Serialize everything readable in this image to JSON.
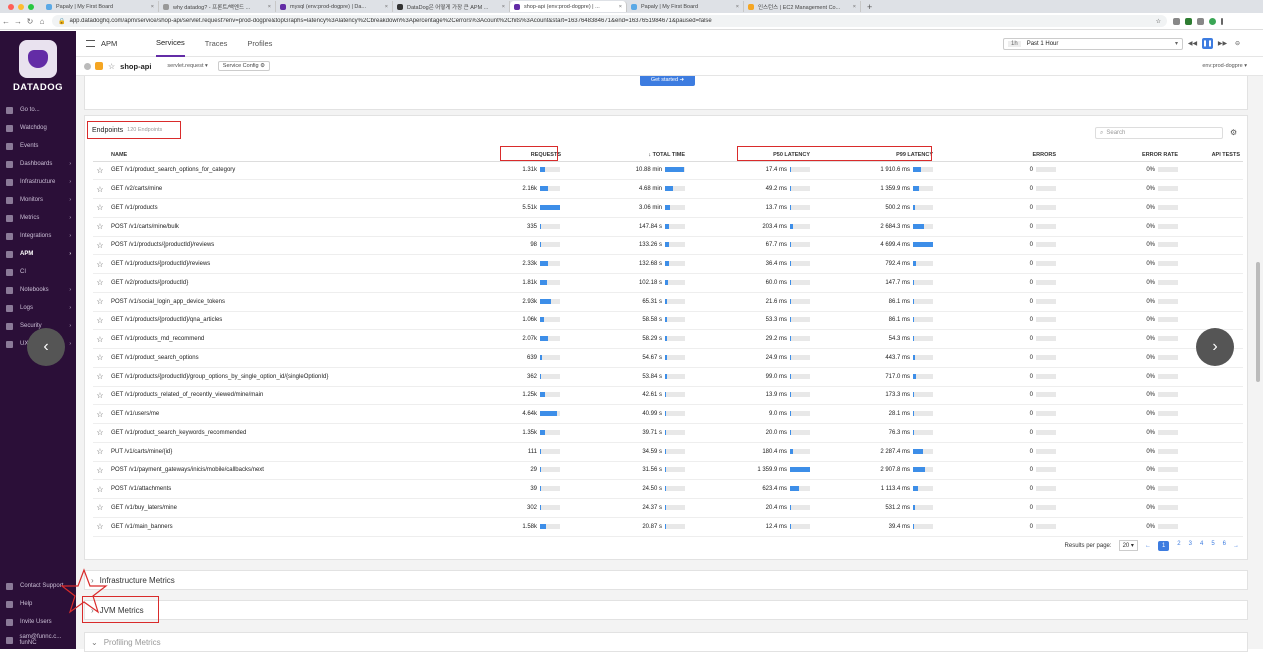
{
  "browser": {
    "tabs": [
      {
        "title": "Papaly | My First Board",
        "active": false,
        "color": "#5aa9e6"
      },
      {
        "title": "why datadog? - 프론트/백엔드 ...",
        "active": false,
        "color": "#999999"
      },
      {
        "title": "mysql (env:prod-dogpre) | Da...",
        "active": false,
        "color": "#632ca6"
      },
      {
        "title": "DataDog은 어떻게 가장 큰 APM ...",
        "active": false,
        "color": "#333333"
      },
      {
        "title": "shop-api (env:prod-dogpre) | ...",
        "active": true,
        "color": "#632ca6"
      },
      {
        "title": "Papaly | My First Board",
        "active": false,
        "color": "#5aa9e6"
      },
      {
        "title": "인스턴스 | EC2 Management Co...",
        "active": false,
        "color": "#f5a623"
      }
    ],
    "new_tab": "+",
    "url": "app.datadoghq.com/apm/service/shop-api/servlet.request?env=prod-dogpre&topGraphs=latency%3Alatency%2Cbreakdown%3Apercentage%2Cerrors%3Acount%2Chits%3Acount&start=1637648384671&end=1637651984671&paused=false"
  },
  "sidebar": {
    "brand": "DATADOG",
    "items": [
      {
        "label": "Go to...",
        "active": false,
        "arrow": ""
      },
      {
        "label": "Watchdog",
        "active": false,
        "arrow": ""
      },
      {
        "label": "Events",
        "active": false,
        "arrow": ""
      },
      {
        "label": "Dashboards",
        "active": false,
        "arrow": "›"
      },
      {
        "label": "Infrastructure",
        "active": false,
        "arrow": "›"
      },
      {
        "label": "Monitors",
        "active": false,
        "arrow": "›"
      },
      {
        "label": "Metrics",
        "active": false,
        "arrow": "›"
      },
      {
        "label": "Integrations",
        "active": false,
        "arrow": "›"
      },
      {
        "label": "APM",
        "active": true,
        "arrow": "›"
      },
      {
        "label": "CI",
        "active": false,
        "arrow": ""
      },
      {
        "label": "Notebooks",
        "active": false,
        "arrow": "›"
      },
      {
        "label": "Logs",
        "active": false,
        "arrow": "›"
      },
      {
        "label": "Security",
        "active": false,
        "arrow": "›"
      },
      {
        "label": "UX Monitoring",
        "active": false,
        "arrow": "›"
      }
    ],
    "bottom": [
      {
        "label": "Contact Support"
      },
      {
        "label": "Help"
      },
      {
        "label": "Invite Users"
      },
      {
        "label": "sam@funnc.c... funNC"
      }
    ]
  },
  "subnav": {
    "section": "APM",
    "tabs": [
      {
        "label": "Services",
        "active": true
      },
      {
        "label": "Traces",
        "active": false
      },
      {
        "label": "Profiles",
        "active": false
      }
    ],
    "time_pill": "1h",
    "time_label": "Past 1 Hour",
    "pause_icon": "❚❚"
  },
  "service_bar": {
    "service": "shop-api",
    "operation": "servlet.request",
    "config": "Service Config",
    "env": "env:prod-dogpre"
  },
  "get_started": "Get started",
  "endpoints": {
    "title": "Endpoints",
    "count": "120 Endpoints",
    "search_placeholder": "Search",
    "columns": {
      "name": "NAME",
      "requests": "REQUESTS",
      "total_time": "↓ TOTAL TIME",
      "p50": "P50 LATENCY",
      "p99": "P99 LATENCY",
      "errors": "ERRORS",
      "error_rate": "ERROR RATE",
      "api_tests": "API TESTS"
    },
    "rows": [
      {
        "name": "GET /v1/product_search_options_for_category",
        "requests": "1.31k",
        "req_fill": 0.24,
        "total": "10.88 min",
        "tot_fill": 0.95,
        "p50": "17.4 ms",
        "p50_fill": 0.01,
        "p99": "1 910.6 ms",
        "p99_fill": 0.38,
        "errors": "0",
        "err_fill": 0,
        "rate": "0%",
        "rate_fill": 0
      },
      {
        "name": "GET /v2/carts/mine",
        "requests": "2.16k",
        "req_fill": 0.39,
        "total": "4.68 min",
        "tot_fill": 0.41,
        "p50": "49.2 ms",
        "p50_fill": 0.04,
        "p99": "1 359.9 ms",
        "p99_fill": 0.28,
        "errors": "0",
        "err_fill": 0,
        "rate": "0%",
        "rate_fill": 0
      },
      {
        "name": "GET /v1/products",
        "requests": "5.51k",
        "req_fill": 1.0,
        "total": "3.06 min",
        "tot_fill": 0.27,
        "p50": "13.7 ms",
        "p50_fill": 0.01,
        "p99": "500.2 ms",
        "p99_fill": 0.1,
        "errors": "0",
        "err_fill": 0,
        "rate": "0%",
        "rate_fill": 0
      },
      {
        "name": "POST /v1/carts/mine/bulk",
        "requests": "335",
        "req_fill": 0.06,
        "total": "147.84 s",
        "tot_fill": 0.22,
        "p50": "203.4 ms",
        "p50_fill": 0.15,
        "p99": "2 684.3 ms",
        "p99_fill": 0.56,
        "errors": "0",
        "err_fill": 0,
        "rate": "0%",
        "rate_fill": 0
      },
      {
        "name": "POST /v1/products/{productId}/reviews",
        "requests": "98",
        "req_fill": 0.02,
        "total": "133.26 s",
        "tot_fill": 0.2,
        "p50": "67.7 ms",
        "p50_fill": 0.05,
        "p99": "4 699.4 ms",
        "p99_fill": 1.0,
        "errors": "0",
        "err_fill": 0,
        "rate": "0%",
        "rate_fill": 0
      },
      {
        "name": "GET /v1/products/{productId}/reviews",
        "requests": "2.33k",
        "req_fill": 0.42,
        "total": "132.68 s",
        "tot_fill": 0.2,
        "p50": "36.4 ms",
        "p50_fill": 0.03,
        "p99": "792.4 ms",
        "p99_fill": 0.17,
        "errors": "0",
        "err_fill": 0,
        "rate": "0%",
        "rate_fill": 0
      },
      {
        "name": "GET /v2/products/{productId}",
        "requests": "1.81k",
        "req_fill": 0.33,
        "total": "102.18 s",
        "tot_fill": 0.16,
        "p50": "60.0 ms",
        "p50_fill": 0.04,
        "p99": "147.7 ms",
        "p99_fill": 0.03,
        "errors": "0",
        "err_fill": 0,
        "rate": "0%",
        "rate_fill": 0
      },
      {
        "name": "POST /v1/social_login_app_device_tokens",
        "requests": "2.93k",
        "req_fill": 0.53,
        "total": "65.31 s",
        "tot_fill": 0.1,
        "p50": "21.6 ms",
        "p50_fill": 0.02,
        "p99": "86.1 ms",
        "p99_fill": 0.02,
        "errors": "0",
        "err_fill": 0,
        "rate": "0%",
        "rate_fill": 0
      },
      {
        "name": "GET /v1/products/{productId}/qna_articles",
        "requests": "1.06k",
        "req_fill": 0.19,
        "total": "58.58 s",
        "tot_fill": 0.09,
        "p50": "53.3 ms",
        "p50_fill": 0.04,
        "p99": "86.1 ms",
        "p99_fill": 0.02,
        "errors": "0",
        "err_fill": 0,
        "rate": "0%",
        "rate_fill": 0
      },
      {
        "name": "GET /v1/products_md_recommend",
        "requests": "2.07k",
        "req_fill": 0.38,
        "total": "58.29 s",
        "tot_fill": 0.09,
        "p50": "29.2 ms",
        "p50_fill": 0.02,
        "p99": "54.3 ms",
        "p99_fill": 0.01,
        "errors": "0",
        "err_fill": 0,
        "rate": "0%",
        "rate_fill": 0
      },
      {
        "name": "GET /v1/product_search_options",
        "requests": "639",
        "req_fill": 0.12,
        "total": "54.67 s",
        "tot_fill": 0.08,
        "p50": "24.9 ms",
        "p50_fill": 0.02,
        "p99": "443.7 ms",
        "p99_fill": 0.09,
        "errors": "0",
        "err_fill": 0,
        "rate": "0%",
        "rate_fill": 0
      },
      {
        "name": "GET /v1/products/{productId}/group_options_by_single_option_id/{singleOptionId}",
        "requests": "362",
        "req_fill": 0.07,
        "total": "53.84 s",
        "tot_fill": 0.08,
        "p50": "99.0 ms",
        "p50_fill": 0.07,
        "p99": "717.0 ms",
        "p99_fill": 0.15,
        "errors": "0",
        "err_fill": 0,
        "rate": "0%",
        "rate_fill": 0
      },
      {
        "name": "GET /v1/products_related_of_recently_viewed/mine/main",
        "requests": "1.25k",
        "req_fill": 0.23,
        "total": "42.61 s",
        "tot_fill": 0.07,
        "p50": "13.9 ms",
        "p50_fill": 0.01,
        "p99": "173.3 ms",
        "p99_fill": 0.04,
        "errors": "0",
        "err_fill": 0,
        "rate": "0%",
        "rate_fill": 0
      },
      {
        "name": "GET /v1/users/me",
        "requests": "4.64k",
        "req_fill": 0.84,
        "total": "40.99 s",
        "tot_fill": 0.06,
        "p50": "9.0 ms",
        "p50_fill": 0.01,
        "p99": "28.1 ms",
        "p99_fill": 0.01,
        "errors": "0",
        "err_fill": 0,
        "rate": "0%",
        "rate_fill": 0
      },
      {
        "name": "GET /v1/product_search_keywords_recommended",
        "requests": "1.35k",
        "req_fill": 0.25,
        "total": "39.71 s",
        "tot_fill": 0.06,
        "p50": "20.0 ms",
        "p50_fill": 0.01,
        "p99": "76.3 ms",
        "p99_fill": 0.02,
        "errors": "0",
        "err_fill": 0,
        "rate": "0%",
        "rate_fill": 0
      },
      {
        "name": "PUT /v1/carts/mine/{id}",
        "requests": "111",
        "req_fill": 0.02,
        "total": "34.59 s",
        "tot_fill": 0.05,
        "p50": "180.4 ms",
        "p50_fill": 0.13,
        "p99": "2 287.4 ms",
        "p99_fill": 0.49,
        "errors": "0",
        "err_fill": 0,
        "rate": "0%",
        "rate_fill": 0
      },
      {
        "name": "POST /v1/payment_gateways/inicis/mobile/callbacks/next",
        "requests": "29",
        "req_fill": 0.01,
        "total": "31.56 s",
        "tot_fill": 0.05,
        "p50": "1 359.9 ms",
        "p50_fill": 1.0,
        "p99": "2 907.8 ms",
        "p99_fill": 0.62,
        "errors": "0",
        "err_fill": 0,
        "rate": "0%",
        "rate_fill": 0
      },
      {
        "name": "POST /v1/attachments",
        "requests": "39",
        "req_fill": 0.01,
        "total": "24.50 s",
        "tot_fill": 0.04,
        "p50": "623.4 ms",
        "p50_fill": 0.46,
        "p99": "1 113.4 ms",
        "p99_fill": 0.24,
        "errors": "0",
        "err_fill": 0,
        "rate": "0%",
        "rate_fill": 0
      },
      {
        "name": "GET /v1/buy_laters/mine",
        "requests": "302",
        "req_fill": 0.05,
        "total": "24.37 s",
        "tot_fill": 0.04,
        "p50": "20.4 ms",
        "p50_fill": 0.02,
        "p99": "531.2 ms",
        "p99_fill": 0.11,
        "errors": "0",
        "err_fill": 0,
        "rate": "0%",
        "rate_fill": 0
      },
      {
        "name": "GET /v1/main_banners",
        "requests": "1.58k",
        "req_fill": 0.29,
        "total": "20.87 s",
        "tot_fill": 0.03,
        "p50": "12.4 ms",
        "p50_fill": 0.01,
        "p99": "39.4 ms",
        "p99_fill": 0.01,
        "errors": "0",
        "err_fill": 0,
        "rate": "0%",
        "rate_fill": 0
      }
    ],
    "pager": {
      "label": "Results per page:",
      "per_page": "20",
      "pages": [
        "1",
        "2",
        "3",
        "4",
        "5",
        "6"
      ],
      "current": "1",
      "prev": "←",
      "next": "→"
    }
  },
  "sections": [
    {
      "label": "Infrastructure Metrics"
    },
    {
      "label": "JVM Metrics"
    },
    {
      "label": "Profiling Metrics"
    }
  ],
  "colors": {
    "sidebar_bg": "#2b0f38",
    "accent": "#632ca6",
    "bar_blue": "#3d8ee8",
    "highlight_red": "#d92b2b"
  }
}
